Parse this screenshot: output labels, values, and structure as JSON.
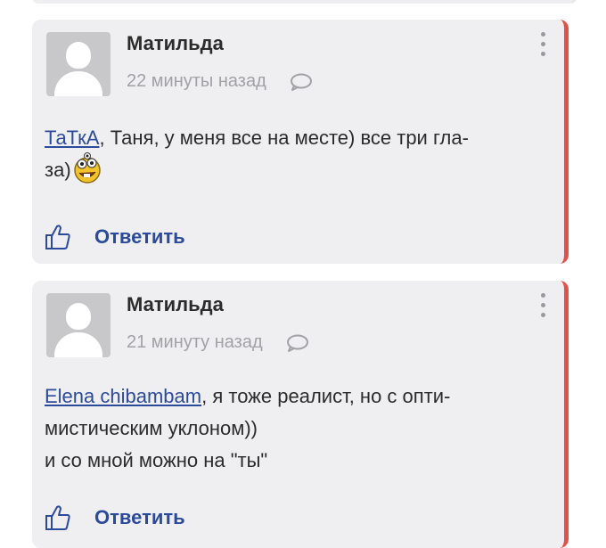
{
  "comments": [
    {
      "author": "Матильда",
      "time": "22 минуты назад",
      "mention": "ТаТкА",
      "text_line1": ", Таня, у меня все на месте) все три гла-",
      "text_line2": "за)",
      "reply_label": "Ответить"
    },
    {
      "author": "Матильда",
      "time": "21 минуту назад",
      "mention": "Elena chibambam",
      "text_line1": ", я тоже реалист, но с опти-",
      "text_line2": "мистическим уклоном))",
      "text_line3": "и со мной можно на \"ты\"",
      "reply_label": "Ответить"
    }
  ],
  "colors": {
    "card_bg": "#efeff1",
    "accent_border": "#e0524c",
    "link": "#2c4a9a",
    "muted": "#a2a2a6"
  },
  "icons": [
    "avatar-placeholder",
    "comment-bubble-icon",
    "more-menu-icon",
    "thumbs-up-icon",
    "smiley-emoji-icon"
  ]
}
